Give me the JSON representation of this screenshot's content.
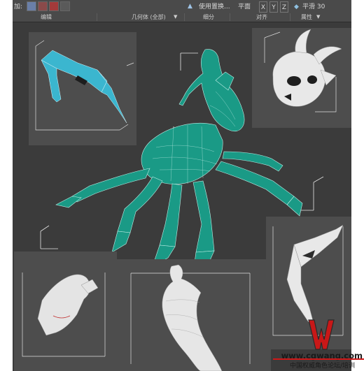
{
  "ribbon": {
    "left_label": "加:",
    "top_items": {
      "use_replace": "使用置换...",
      "plane": "平面",
      "axis_x": "X",
      "axis_y": "Y",
      "axis_z": "Z",
      "smooth": "平滑 30"
    },
    "section_labels": {
      "edit": "编辑",
      "geometry": "几何体 (全部)",
      "subdivision": "细分",
      "align": "对齐",
      "properties": "属性"
    }
  },
  "watermark": {
    "url": "www.cgwang.com",
    "caption": "中国权威角色论坛/培训",
    "brand_color": "#c81818"
  },
  "colors": {
    "viewport_bg": "#3b3b3b",
    "panel_bg": "#4d4d4d",
    "teal_mesh": "#1a9a86",
    "cyan_mesh": "#3bb6cf",
    "white_mesh": "#e8e8e8"
  }
}
